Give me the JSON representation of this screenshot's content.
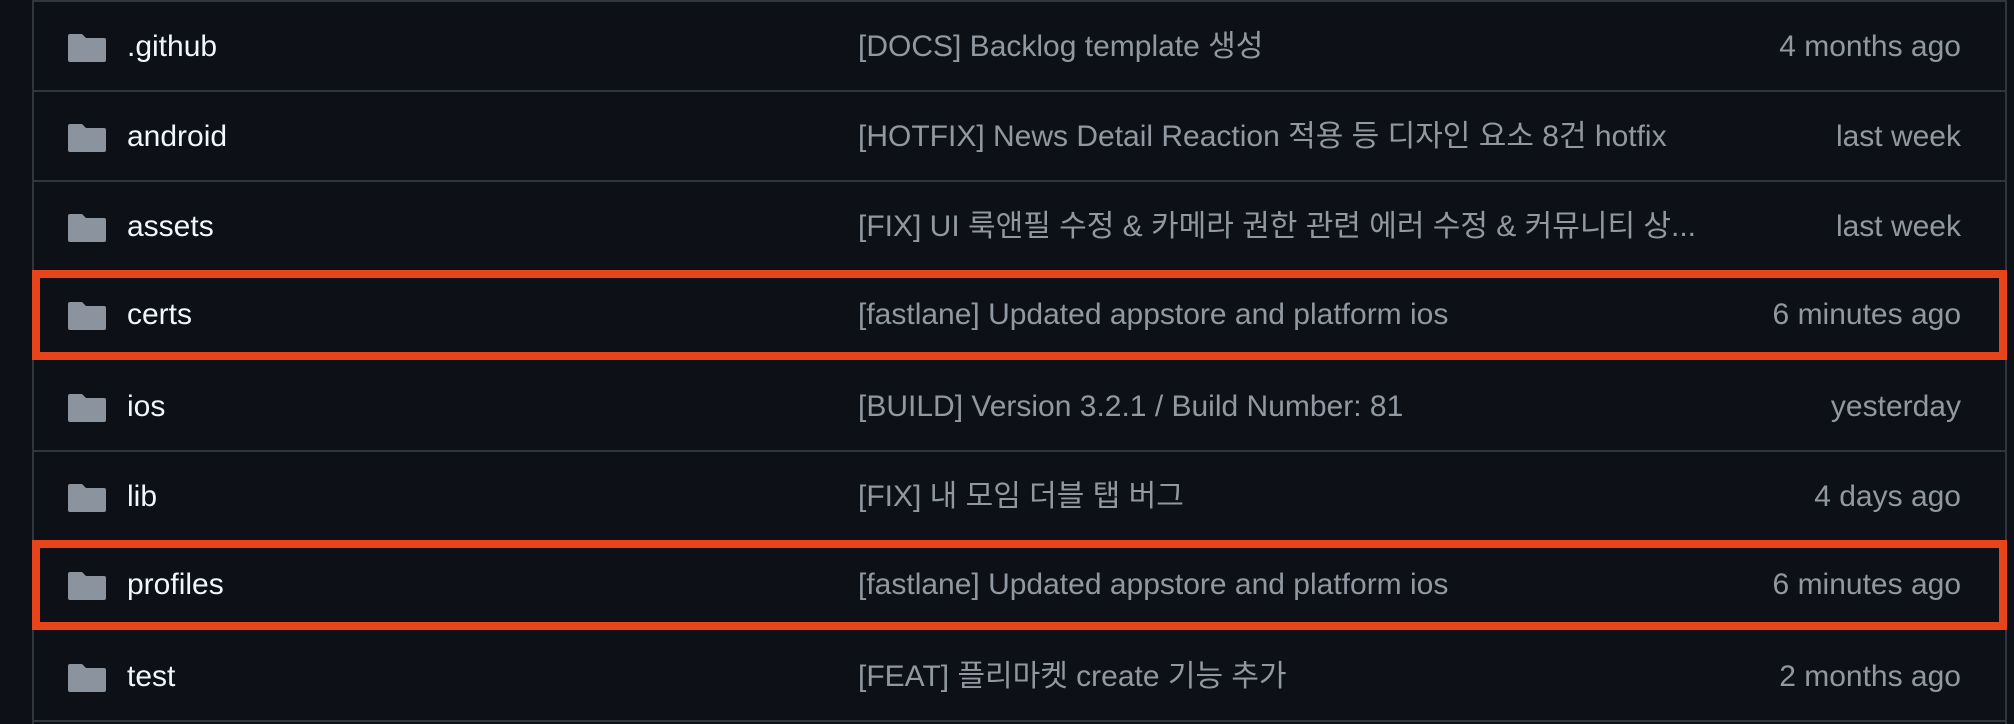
{
  "colors": {
    "background": "#0d1117",
    "border": "#30363d",
    "name_text": "#f0f6fc",
    "muted_text": "#9198a1",
    "folder_icon": "#8b949e",
    "highlight": "#e8441c"
  },
  "files": [
    {
      "name": ".github",
      "icon": "folder-icon",
      "message": "[DOCS] Backlog template 생성",
      "time": "4 months ago",
      "highlighted": false
    },
    {
      "name": "android",
      "icon": "folder-icon",
      "message": "[HOTFIX] News Detail Reaction 적용 등 디자인 요소 8건 hotfix",
      "time": "last week",
      "highlighted": false
    },
    {
      "name": "assets",
      "icon": "folder-icon",
      "message": "[FIX] UI 룩앤필 수정 & 카메라 권한 관련 에러 수정 & 커뮤니티 상...",
      "time": "last week",
      "highlighted": false
    },
    {
      "name": "certs",
      "icon": "folder-icon",
      "message": "[fastlane] Updated appstore and platform ios",
      "time": "6 minutes ago",
      "highlighted": true
    },
    {
      "name": "ios",
      "icon": "folder-icon",
      "message": "[BUILD] Version 3.2.1 / Build Number: 81",
      "time": "yesterday",
      "highlighted": false
    },
    {
      "name": "lib",
      "icon": "folder-icon",
      "message": "[FIX] 내 모임 더블 탭 버그",
      "time": "4 days ago",
      "highlighted": false
    },
    {
      "name": "profiles",
      "icon": "folder-icon",
      "message": "[fastlane] Updated appstore and platform ios",
      "time": "6 minutes ago",
      "highlighted": true
    },
    {
      "name": "test",
      "icon": "folder-icon",
      "message": "[FEAT] 플리마켓 create 기능 추가",
      "time": "2 months ago",
      "highlighted": false
    }
  ]
}
